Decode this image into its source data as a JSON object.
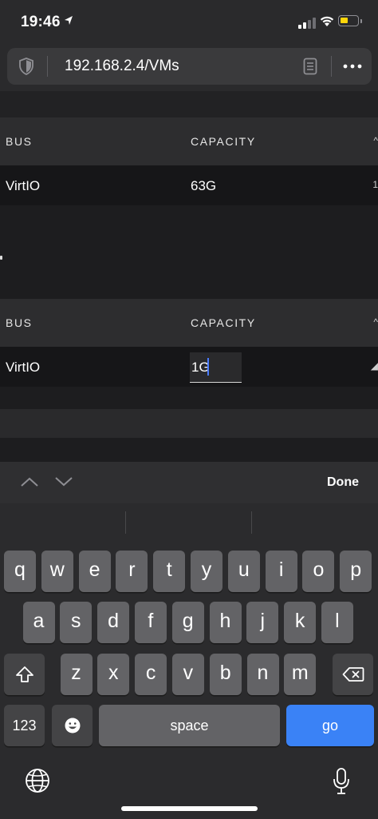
{
  "status_bar": {
    "time": "19:46",
    "battery_level": 0.45
  },
  "browser": {
    "url": "192.168.2.4/VMs"
  },
  "tables": [
    {
      "headers": {
        "bus": "BUS",
        "capacity": "CAPACITY"
      },
      "row": {
        "bus": "VirtIO",
        "capacity": "63G"
      }
    },
    {
      "headers": {
        "bus": "BUS",
        "capacity": "CAPACITY"
      },
      "row": {
        "bus": "VirtIO",
        "capacity_input": "1G"
      }
    }
  ],
  "accessory": {
    "done_label": "Done"
  },
  "keyboard": {
    "row1": [
      "q",
      "w",
      "e",
      "r",
      "t",
      "y",
      "u",
      "i",
      "o",
      "p"
    ],
    "row2": [
      "a",
      "s",
      "d",
      "f",
      "g",
      "h",
      "j",
      "k",
      "l"
    ],
    "row3": [
      "z",
      "x",
      "c",
      "v",
      "b",
      "n",
      "m"
    ],
    "numbers_label": "123",
    "space_label": "space",
    "go_label": "go"
  },
  "colors": {
    "accent": "#3a82f6",
    "battery": "#ffd60a"
  }
}
